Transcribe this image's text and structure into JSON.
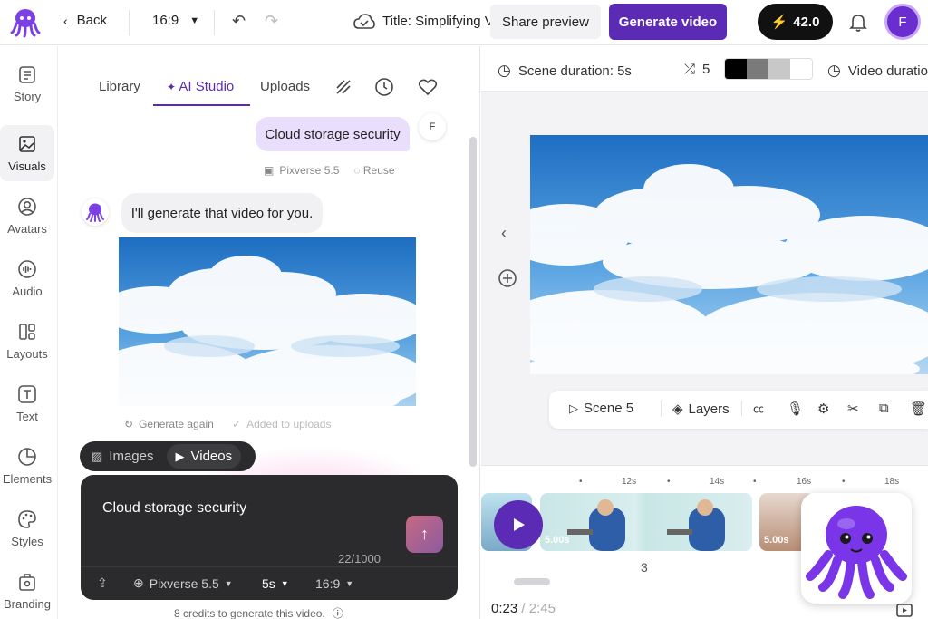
{
  "topbar": {
    "back_label": "Back",
    "aspect_ratio": "16:9",
    "title": "Title: Simplifying Video Creation",
    "share_label": "Share preview",
    "generate_label": "Generate video",
    "credits": "42.0",
    "user_initial": "F",
    "brand_color": "#5b2bb5"
  },
  "sidebar": {
    "items": [
      {
        "label": "Story",
        "icon": "story-icon"
      },
      {
        "label": "Visuals",
        "icon": "image-icon"
      },
      {
        "label": "Avatars",
        "icon": "avatar-icon"
      },
      {
        "label": "Audio",
        "icon": "audio-icon"
      },
      {
        "label": "Layouts",
        "icon": "layout-icon"
      },
      {
        "label": "Text",
        "icon": "text-icon"
      },
      {
        "label": "Elements",
        "icon": "elements-icon"
      },
      {
        "label": "Styles",
        "icon": "palette-icon"
      },
      {
        "label": "Branding",
        "icon": "branding-icon"
      }
    ],
    "active": "Visuals"
  },
  "panel": {
    "tabs": [
      "Library",
      "AI Studio",
      "Uploads"
    ],
    "active_tab": "AI Studio",
    "chat": {
      "user_message": "Cloud storage security",
      "user_initial": "F",
      "model": "Pixverse 5.5",
      "reuse": "Reuse",
      "bot_message": "I'll generate that video for you.",
      "regenerate": "Generate again",
      "added": "Added to uploads"
    },
    "mode_toggle": {
      "images": "Images",
      "videos": "Videos",
      "selected": "Videos"
    },
    "composer": {
      "text": "Cloud storage security",
      "char_count": "22/1000",
      "model": "Pixverse 5.5",
      "duration": "5s",
      "ratio": "16:9"
    },
    "credits_note": "8 credits to generate this video."
  },
  "scene_bar": {
    "scene_duration": "Scene duration: 5s",
    "shuffle_count": "5",
    "swatches": [
      "#000000",
      "#7a7a7a",
      "#c8c8c8",
      "#ffffff"
    ],
    "video_duration": "Video duratio"
  },
  "toolbar": {
    "scene": "Scene 5",
    "layers": "Layers"
  },
  "timeline": {
    "ticks": [
      "12s",
      "14s",
      "16s",
      "18s"
    ],
    "clips": [
      {
        "label": ""
      },
      {
        "label": "5.00s"
      },
      {
        "label": "5.00s"
      }
    ],
    "scene_number": "3",
    "current_time": "0:23",
    "total_time": "2:45"
  }
}
